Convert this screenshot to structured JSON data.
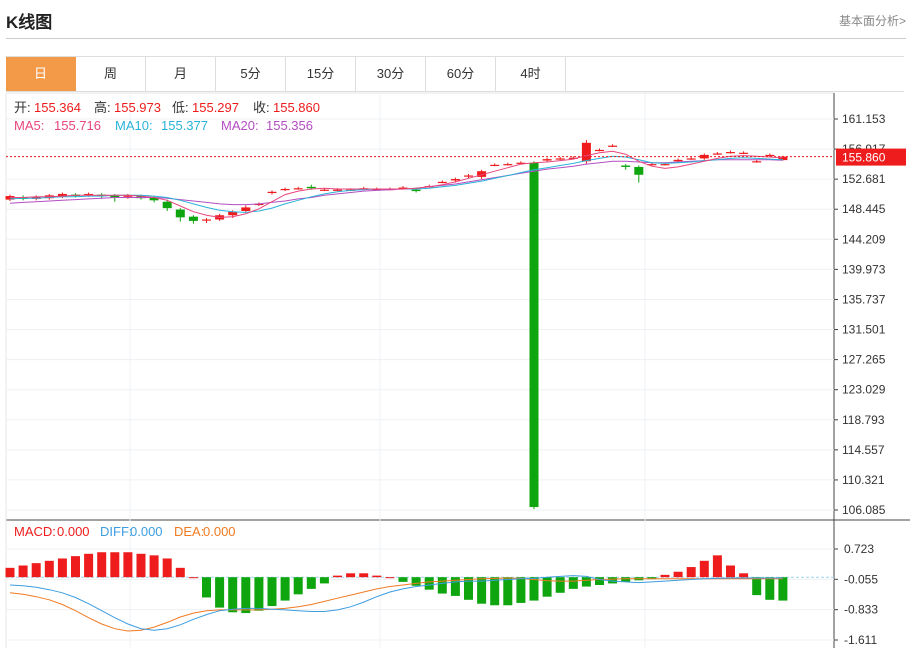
{
  "header": {
    "title": "K线图",
    "link": "基本面分析>"
  },
  "tabs": [
    {
      "label": "日",
      "active": true
    },
    {
      "label": "周"
    },
    {
      "label": "月"
    },
    {
      "label": "5分"
    },
    {
      "label": "15分"
    },
    {
      "label": "30分"
    },
    {
      "label": "60分"
    },
    {
      "label": "4时"
    }
  ],
  "ohlc": {
    "open_label": "开:",
    "open": "155.364",
    "high_label": "高:",
    "high": "155.973",
    "low_label": "低:",
    "low": "155.297",
    "close_label": "收:",
    "close": "155.860"
  },
  "ma": {
    "ma5_label": "MA5:",
    "ma5": "155.716",
    "ma10_label": "MA10:",
    "ma10": "155.377",
    "ma20_label": "MA20:",
    "ma20": "155.356"
  },
  "macd": {
    "macd_label": "MACD:",
    "macd": "0.000",
    "diff_label": "DIFF:",
    "diff": "0.000",
    "dea_label": "DEA:",
    "dea": "0.000"
  },
  "colors": {
    "up": "#ee1c1c",
    "down": "#0ea50e",
    "ma5": "#e8457d",
    "ma10": "#29b3d9",
    "ma20": "#b44ec2",
    "diff": "#3d9de0",
    "dea": "#f07a22",
    "tab_active": "#f39a49"
  },
  "chart_data": [
    {
      "type": "candlestick",
      "y_ticks": [
        "161.153",
        "156.917",
        "152.681",
        "148.445",
        "144.209",
        "139.973",
        "135.737",
        "131.501",
        "127.265",
        "123.029",
        "118.793",
        "114.557",
        "110.321",
        "106.085"
      ],
      "ylim": [
        106.085,
        161.153
      ],
      "last_price": "155.860",
      "candles": [
        [
          149.8,
          150.3,
          149.6,
          150.5
        ],
        [
          150.1,
          149.9,
          149.7,
          150.4
        ],
        [
          149.9,
          150.2,
          149.7,
          150.4
        ],
        [
          150.0,
          150.4,
          149.8,
          150.6
        ],
        [
          150.2,
          150.6,
          150.0,
          150.8
        ],
        [
          150.5,
          150.3,
          150.1,
          150.7
        ],
        [
          150.4,
          150.6,
          150.2,
          150.8
        ],
        [
          150.5,
          150.3,
          150.0,
          150.7
        ],
        [
          150.4,
          150.1,
          149.5,
          150.6
        ],
        [
          150.2,
          150.4,
          149.9,
          150.6
        ],
        [
          150.3,
          150.0,
          149.8,
          150.5
        ],
        [
          150.1,
          149.7,
          149.4,
          150.3
        ],
        [
          149.5,
          148.6,
          148.2,
          149.8
        ],
        [
          148.4,
          147.3,
          146.7,
          148.6
        ],
        [
          147.4,
          146.8,
          146.4,
          147.6
        ],
        [
          146.9,
          147.0,
          146.5,
          147.2
        ],
        [
          147.0,
          147.6,
          146.8,
          147.8
        ],
        [
          147.6,
          148.1,
          147.2,
          148.3
        ],
        [
          148.2,
          148.7,
          148.0,
          149.0
        ],
        [
          149.1,
          149.2,
          148.9,
          149.4
        ],
        [
          150.8,
          150.9,
          150.5,
          151.1
        ],
        [
          151.3,
          151.3,
          151.0,
          151.5
        ],
        [
          151.4,
          151.4,
          151.2,
          151.6
        ],
        [
          151.6,
          151.4,
          151.2,
          151.9
        ],
        [
          151.2,
          151.2,
          151.0,
          151.4
        ],
        [
          151.2,
          151.2,
          151.0,
          151.4
        ],
        [
          151.2,
          151.2,
          151.0,
          151.4
        ],
        [
          151.4,
          151.4,
          151.2,
          151.6
        ],
        [
          151.3,
          151.3,
          151.1,
          151.5
        ],
        [
          151.3,
          151.3,
          151.1,
          151.5
        ],
        [
          151.4,
          151.5,
          151.2,
          151.7
        ],
        [
          151.2,
          151.0,
          150.8,
          151.5
        ],
        [
          151.7,
          151.7,
          151.5,
          151.9
        ],
        [
          152.3,
          152.3,
          152.1,
          152.5
        ],
        [
          152.5,
          152.7,
          152.2,
          152.9
        ],
        [
          153.1,
          153.2,
          152.8,
          153.4
        ],
        [
          153.0,
          153.8,
          152.7,
          154.0
        ],
        [
          154.7,
          154.7,
          154.5,
          154.9
        ],
        [
          154.8,
          154.8,
          154.6,
          155.0
        ],
        [
          155.0,
          155.0,
          154.8,
          155.2
        ],
        [
          155.0,
          106.5,
          106.2,
          155.2
        ],
        [
          155.3,
          155.5,
          155.1,
          155.7
        ],
        [
          155.6,
          155.6,
          155.4,
          155.8
        ],
        [
          155.7,
          155.7,
          155.5,
          155.9
        ],
        [
          155.2,
          157.8,
          154.8,
          158.2
        ],
        [
          156.8,
          156.8,
          156.6,
          157.0
        ],
        [
          157.4,
          157.4,
          157.2,
          157.6
        ],
        [
          154.6,
          154.4,
          154.0,
          154.8
        ],
        [
          154.4,
          153.3,
          152.2,
          154.6
        ],
        [
          154.8,
          154.8,
          154.6,
          155.0
        ],
        [
          154.8,
          154.8,
          154.6,
          155.0
        ],
        [
          155.2,
          155.4,
          155.0,
          155.6
        ],
        [
          155.6,
          155.6,
          155.4,
          155.8
        ],
        [
          155.6,
          156.1,
          155.4,
          156.3
        ],
        [
          156.3,
          156.3,
          156.1,
          156.5
        ],
        [
          156.5,
          156.5,
          156.3,
          156.7
        ],
        [
          156.4,
          156.4,
          156.2,
          156.6
        ],
        [
          155.2,
          155.2,
          155.0,
          155.4
        ],
        [
          156.1,
          156.1,
          155.9,
          156.3
        ],
        [
          155.364,
          155.86,
          155.297,
          155.973
        ]
      ],
      "ma5": [
        150.1,
        150.1,
        150.2,
        150.2,
        150.3,
        150.4,
        150.4,
        150.4,
        150.4,
        150.4,
        150.3,
        150.1,
        149.7,
        148.9,
        148.1,
        147.6,
        147.3,
        147.4,
        147.8,
        148.5,
        149.5,
        150.5,
        151.0,
        151.3,
        151.4,
        151.3,
        151.3,
        151.3,
        151.3,
        151.3,
        151.3,
        151.4,
        151.6,
        151.9,
        152.3,
        152.8,
        153.3,
        153.8,
        154.3,
        154.8,
        155.0,
        155.1,
        155.3,
        155.5,
        156.0,
        156.4,
        156.6,
        156.2,
        155.2,
        154.5,
        154.2,
        154.4,
        154.8,
        155.2,
        155.6,
        155.9,
        156.0,
        155.9,
        155.8,
        155.7
      ],
      "ma10": [
        149.9,
        150.0,
        150.0,
        150.1,
        150.2,
        150.2,
        150.3,
        150.3,
        150.4,
        150.4,
        150.4,
        150.3,
        150.1,
        149.7,
        149.2,
        148.7,
        148.3,
        148.1,
        148.0,
        148.2,
        148.6,
        149.2,
        149.7,
        150.2,
        150.6,
        150.9,
        151.1,
        151.2,
        151.3,
        151.3,
        151.3,
        151.3,
        151.4,
        151.6,
        151.8,
        152.1,
        152.4,
        152.8,
        153.2,
        153.6,
        154.0,
        154.3,
        154.6,
        154.9,
        155.3,
        155.6,
        155.9,
        155.8,
        155.4,
        155.0,
        154.9,
        155.0,
        155.1,
        155.3,
        155.4,
        155.6,
        155.7,
        155.6,
        155.5,
        155.4
      ],
      "ma20": [
        149.3,
        149.4,
        149.5,
        149.6,
        149.7,
        149.8,
        149.9,
        150.0,
        150.1,
        150.1,
        150.1,
        150.1,
        150.0,
        149.8,
        149.6,
        149.4,
        149.2,
        149.1,
        149.1,
        149.2,
        149.4,
        149.6,
        149.9,
        150.1,
        150.4,
        150.6,
        150.8,
        151.0,
        151.1,
        151.2,
        151.3,
        151.4,
        151.6,
        151.8,
        152.0,
        152.3,
        152.6,
        152.9,
        153.2,
        153.5,
        153.8,
        154.1,
        154.3,
        154.5,
        154.8,
        155.0,
        155.2,
        155.2,
        155.1,
        155.0,
        155.0,
        155.1,
        155.2,
        155.3,
        155.4,
        155.4,
        155.4,
        155.4,
        155.4,
        155.356
      ]
    },
    {
      "type": "macd",
      "y_ticks": [
        "0.723",
        "-0.055",
        "-0.833",
        "-1.611"
      ],
      "ylim": [
        -1.611,
        0.723
      ],
      "macd_bars": [
        0.24,
        0.3,
        0.36,
        0.42,
        0.48,
        0.54,
        0.6,
        0.64,
        0.64,
        0.64,
        0.6,
        0.56,
        0.48,
        0.24,
        0.0,
        -0.52,
        -0.78,
        -0.9,
        -0.92,
        -0.86,
        -0.74,
        -0.6,
        -0.44,
        -0.3,
        -0.16,
        0.04,
        0.1,
        0.1,
        0.04,
        0.0,
        -0.12,
        -0.22,
        -0.32,
        -0.42,
        -0.48,
        -0.58,
        -0.68,
        -0.72,
        -0.72,
        -0.66,
        -0.6,
        -0.5,
        -0.4,
        -0.3,
        -0.24,
        -0.2,
        -0.16,
        -0.12,
        -0.08,
        -0.05,
        0.06,
        0.14,
        0.26,
        0.42,
        0.56,
        0.3,
        0.1,
        -0.46,
        -0.58,
        -0.6
      ],
      "diff": [
        -0.2,
        -0.22,
        -0.26,
        -0.32,
        -0.4,
        -0.52,
        -0.68,
        -0.86,
        -1.04,
        -1.2,
        -1.32,
        -1.36,
        -1.32,
        -1.22,
        -1.08,
        -0.96,
        -0.86,
        -0.82,
        -0.8,
        -0.8,
        -0.82,
        -0.84,
        -0.86,
        -0.88,
        -0.88,
        -0.84,
        -0.76,
        -0.64,
        -0.5,
        -0.38,
        -0.3,
        -0.24,
        -0.2,
        -0.16,
        -0.12,
        -0.1,
        -0.1,
        -0.08,
        -0.06,
        -0.04,
        -0.03,
        0.0,
        0.02,
        0.04,
        0.02,
        -0.06,
        -0.1,
        -0.12,
        -0.14,
        -0.12,
        -0.1,
        -0.08,
        -0.06,
        -0.04,
        -0.03,
        -0.02,
        -0.02,
        -0.02,
        -0.02,
        -0.02
      ],
      "dea": [
        -0.4,
        -0.44,
        -0.5,
        -0.58,
        -0.7,
        -0.86,
        -1.04,
        -1.2,
        -1.32,
        -1.38,
        -1.36,
        -1.28,
        -1.16,
        -1.02,
        -0.92,
        -0.86,
        -0.84,
        -0.84,
        -0.84,
        -0.84,
        -0.82,
        -0.8,
        -0.76,
        -0.7,
        -0.62,
        -0.54,
        -0.46,
        -0.38,
        -0.3,
        -0.24,
        -0.2,
        -0.16,
        -0.12,
        -0.1,
        -0.08,
        -0.06,
        -0.04,
        -0.03,
        -0.02,
        -0.03,
        -0.06,
        -0.09,
        -0.1,
        -0.1,
        -0.08,
        -0.06,
        -0.05,
        -0.04,
        -0.04,
        -0.04,
        -0.04,
        -0.04,
        -0.04,
        -0.04,
        -0.04,
        -0.04,
        -0.04,
        -0.04,
        -0.04,
        -0.04
      ]
    }
  ]
}
